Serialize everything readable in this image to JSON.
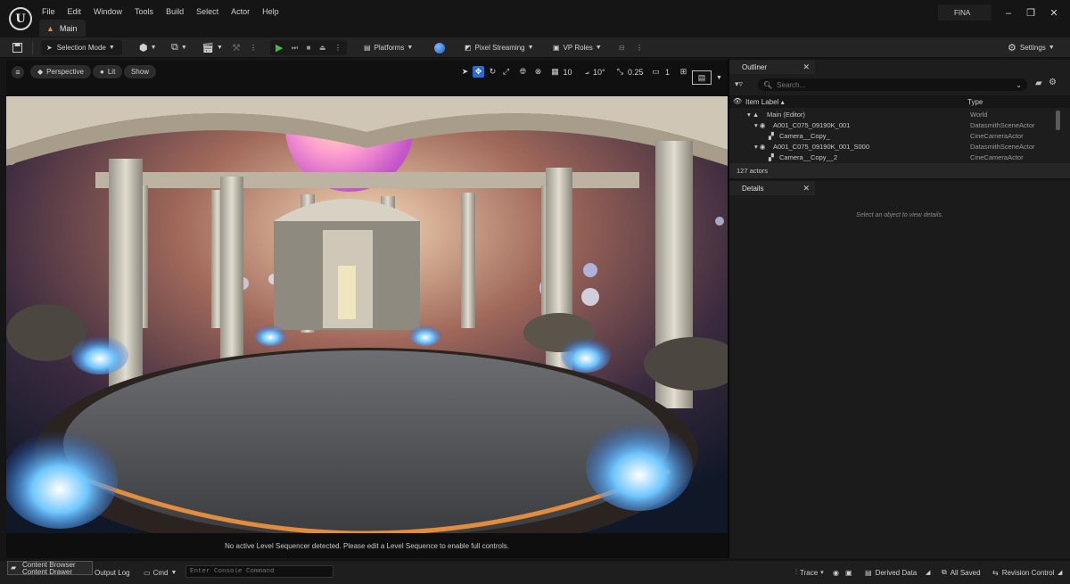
{
  "app": {
    "logo": "U",
    "project_name": "FINA",
    "level_tab": "Main"
  },
  "menu": [
    "File",
    "Edit",
    "Window",
    "Tools",
    "Build",
    "Select",
    "Actor",
    "Help"
  ],
  "window_controls": {
    "minimize": "–",
    "maximize": "❐",
    "close": "✕"
  },
  "toolbar": {
    "selection_mode": "Selection Mode",
    "platforms": "Platforms",
    "pixel_streaming": "Pixel Streaming",
    "vp_roles": "VP Roles",
    "settings": "Settings"
  },
  "viewport": {
    "perspective": "Perspective",
    "lit": "Lit",
    "show": "Show",
    "grid_snap": "10",
    "rotation_snap": "10°",
    "scale_snap": "0.25",
    "camera_speed": "1",
    "message": "No active Level Sequencer detected. Please edit a Level Sequence to enable full controls."
  },
  "outliner": {
    "tab": "Outliner",
    "search_placeholder": "Search...",
    "col_label": "Item Label ▴",
    "col_type": "Type",
    "rows": [
      {
        "label": "Main (Editor)",
        "type": "World"
      },
      {
        "label": "A001_C075_09190K_001",
        "type": "DatasmithSceneActor"
      },
      {
        "label": "Camera__Copy_",
        "type": "CineCameraActor"
      },
      {
        "label": "A001_C075_09190K_001_S000",
        "type": "DatasmithSceneActor"
      },
      {
        "label": "Camera__Copy__2",
        "type": "CineCameraActor"
      }
    ],
    "actor_count": "127 actors"
  },
  "details": {
    "tab": "Details",
    "hint": "Select an object to view details."
  },
  "statusbar": {
    "content_browser": "Content Browser",
    "content_drawer": "Content Drawer",
    "output_log": "Output Log",
    "cmd": "Cmd",
    "console_placeholder": "Enter Console Command",
    "trace": "Trace",
    "derived_data": "Derived Data",
    "all_saved": "All Saved",
    "revision_control": "Revision Control"
  }
}
